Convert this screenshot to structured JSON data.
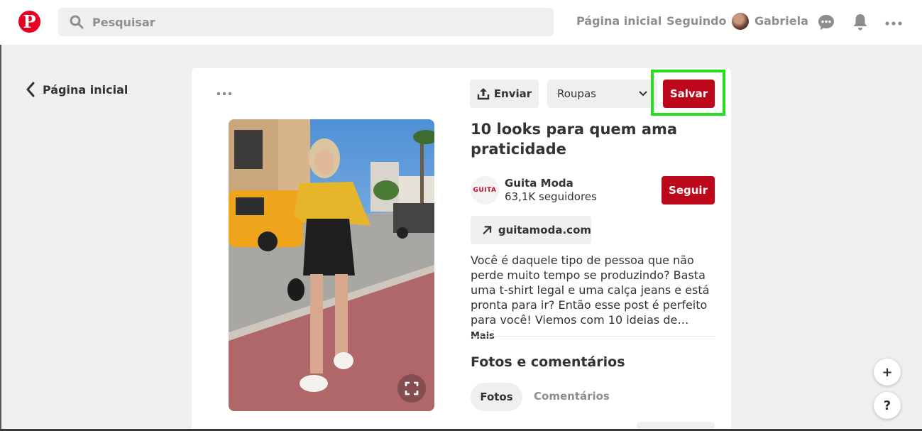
{
  "header": {
    "search": {
      "placeholder": "Pesquisar"
    },
    "nav": {
      "home": "Página inicial",
      "following": "Seguindo",
      "user": "Gabriela"
    }
  },
  "back_link": {
    "label": "Página inicial"
  },
  "pin": {
    "send_label": "Enviar",
    "board_select_value": "Roupas",
    "save_label": "Salvar",
    "title": "10 looks para quem ama praticidade",
    "creator": {
      "logo_text": "GUITA",
      "name": "Guita Moda",
      "followers": "63,1K seguidores",
      "follow_label": "Seguir"
    },
    "link_label": "guitamoda.com",
    "description": "Você é daquele tipo de pessoa que não perde muito tempo se produzindo? Basta uma t-shirt legal e uma calça jeans e está pronta para ir? Então esse post é perfeito para você! Viemos com 10 ideias de…",
    "more_label": "Mais",
    "section_title": "Fotos e comentários",
    "tabs": {
      "photos": "Fotos",
      "comments": "Comentários"
    }
  },
  "floating": {
    "add": "+",
    "help": "?"
  },
  "colors": {
    "brand_red": "#e60023",
    "action_red": "#bd081c",
    "highlight": "#22e01c"
  }
}
